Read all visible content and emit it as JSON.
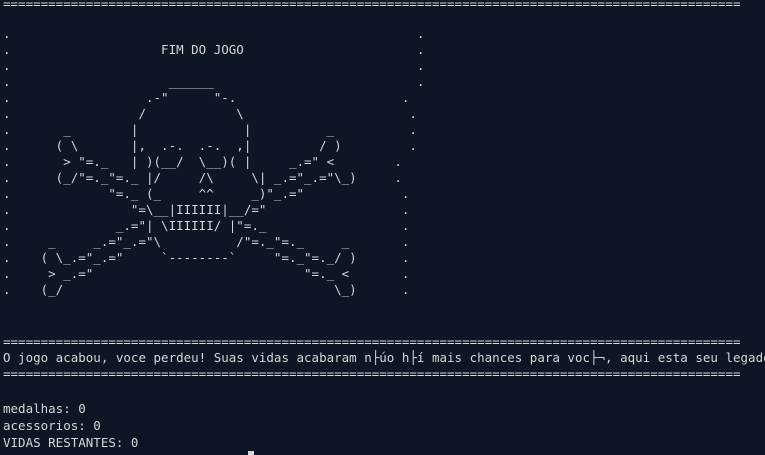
{
  "separator": "==================================================================================================",
  "game_over_art": ".                                                      .\n.                    FIM DO JOGO                       .\n.                                                      .\n.                     ______                           .\n.                  .-\"      \"-.                      .\n.                 /            \\                      .\n.       _        |              |          _          .\n.      ( \\       |,  .-.  .-.  ,|         / )         .\n.       > \"=._   | )(__/  \\__)( |     _.=\" <        .\n.      (_/\"=._\"=._ |/     /\\     \\| _.=\"_.=\"\\_)     .\n.             \"=._ (_     ^^     _)\"_.=\"             .\n.                \"=\\__|IIIIII|__/=\"                  .\n.              _.=\"| \\IIIIII/ |\"=._                  .\n.     _     _.=\"_.=\"\\          /\"=._\"=._     _       .\n.    ( \\_.=\"_.=\"     `--------`     \"=._\"=._/ )      .\n.     > _.=\"                            \"=._ <       .\n.    (_/                                    \\_)      .",
  "message": "O jogo acabou, voce perdeu! Suas vidas acabaram n├úo h├í mais chances para voc├¬, aqui esta seu legado:",
  "stats": {
    "medals": "medalhas: 0",
    "accessories": "acessorios: 0",
    "lives": "VIDAS RESTANTES: 0"
  }
}
